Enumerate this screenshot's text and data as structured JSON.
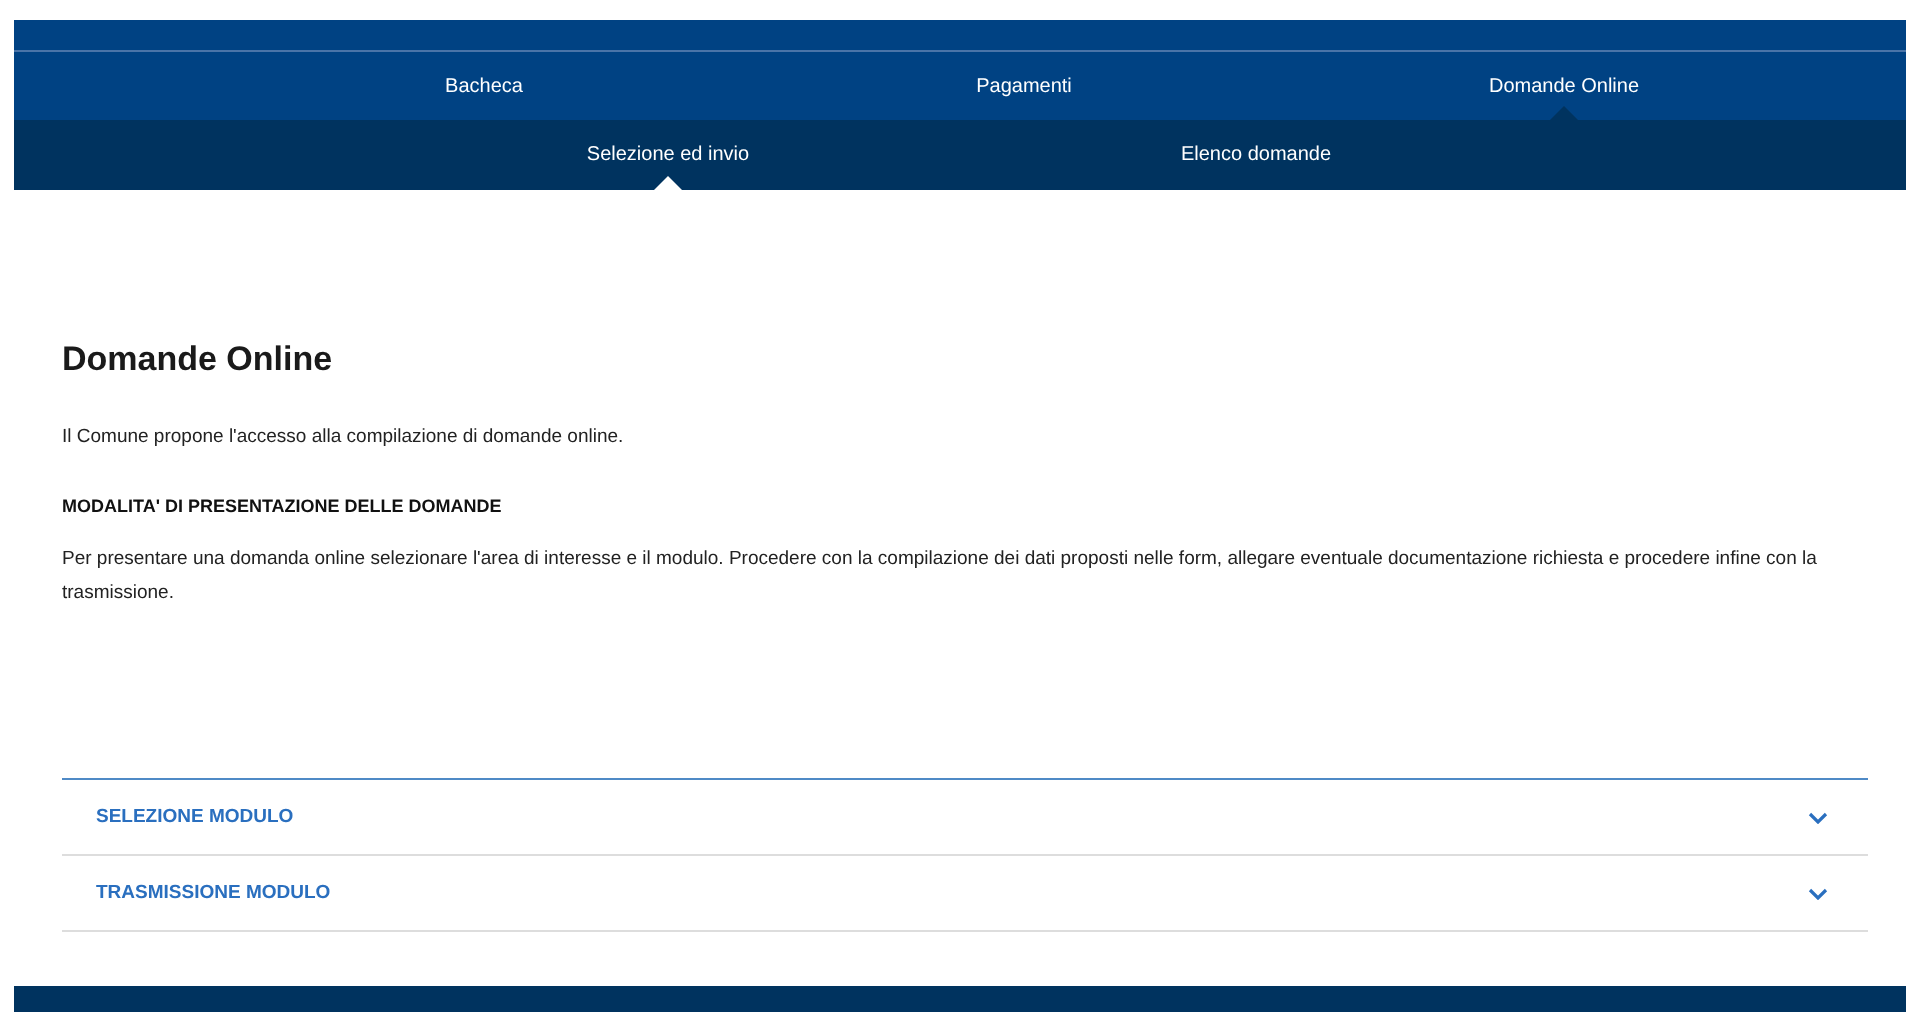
{
  "main_nav": [
    {
      "label": "Bacheca",
      "selected": false
    },
    {
      "label": "Pagamenti",
      "selected": false
    },
    {
      "label": "Domande Online",
      "selected": true
    }
  ],
  "sub_nav": [
    {
      "label": "Selezione ed invio",
      "selected": true
    },
    {
      "label": "Elenco domande",
      "selected": false
    }
  ],
  "title": "Domande Online",
  "intro": "Il Comune propone l'accesso alla compilazione di domande online.",
  "section_heading": "MODALITA' DI PRESENTAZIONE DELLE DOMANDE",
  "section_text": "Per presentare una domanda online selezionare l'area di interesse e il modulo. Procedere con la compilazione dei dati proposti nelle form, allegare eventuale documentazione richiesta e procedere infine con la trasmissione.",
  "accordion": [
    {
      "label": "SELEZIONE MODULO",
      "expanded": false
    },
    {
      "label": "TRASMISSIONE MODULO",
      "expanded": false
    }
  ]
}
